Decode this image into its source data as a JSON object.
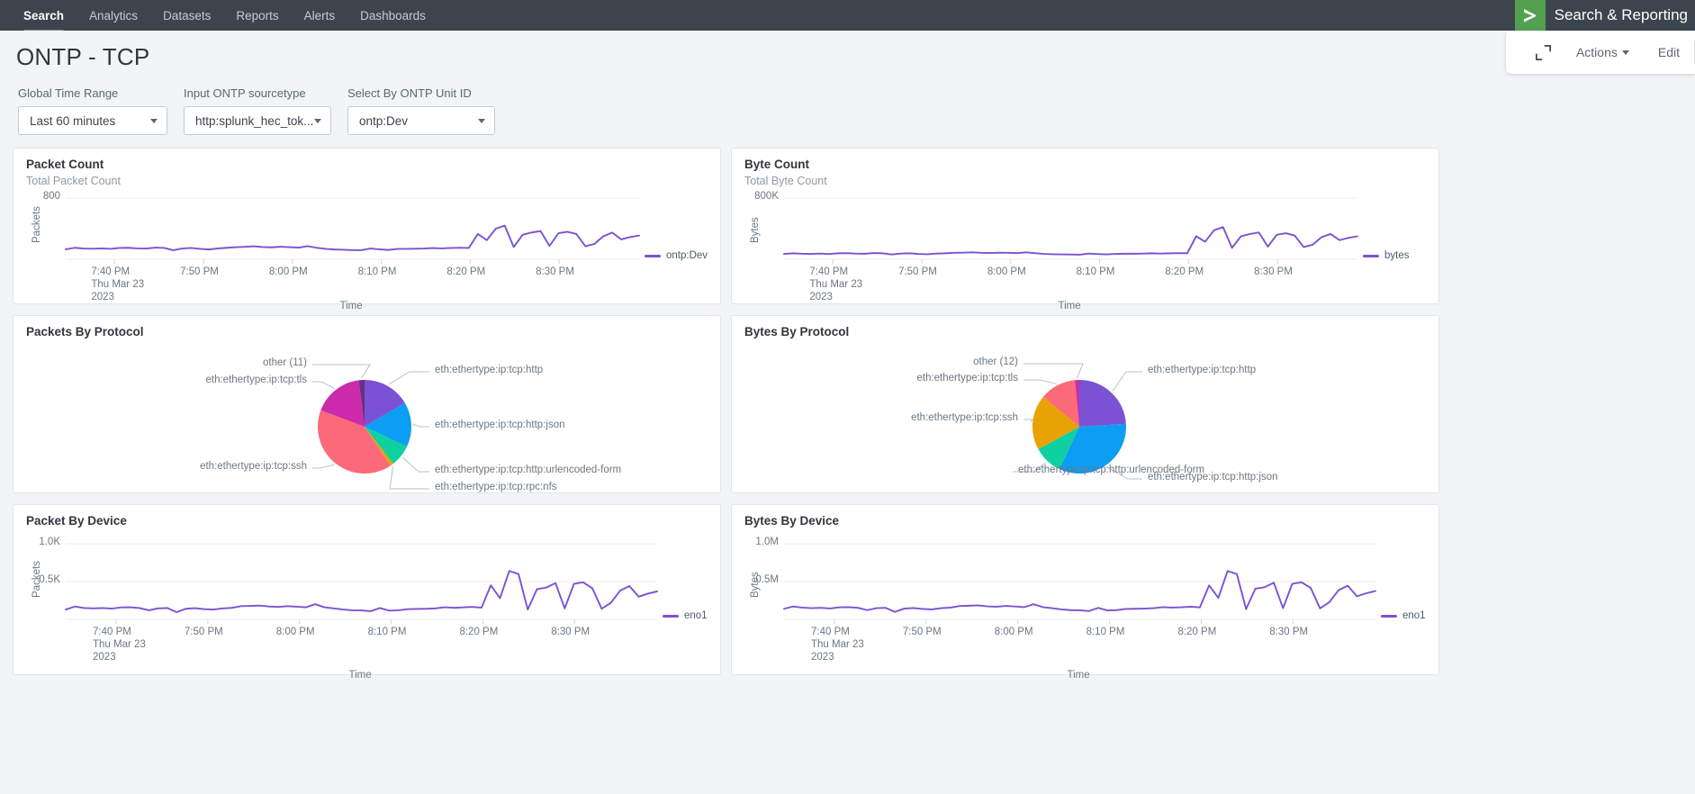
{
  "nav": {
    "items": [
      {
        "label": "Search",
        "active": true
      },
      {
        "label": "Analytics",
        "active": false
      },
      {
        "label": "Datasets",
        "active": false
      },
      {
        "label": "Reports",
        "active": false
      },
      {
        "label": "Alerts",
        "active": false
      },
      {
        "label": "Dashboards",
        "active": false
      }
    ],
    "brand_title": "Search & Reporting",
    "brand_glyph": "›",
    "brand_color": "#53a051"
  },
  "header": {
    "title": "ONTP - TCP",
    "expand_icon": "expand-icon",
    "actions_label": "Actions",
    "edit_label": "Edit"
  },
  "filters": [
    {
      "label": "Global Time Range",
      "value": "Last 60 minutes",
      "name": "global-time-range"
    },
    {
      "label": "Input ONTP sourcetype",
      "value": "http:splunk_hec_tok...",
      "name": "input-ontp-sourcetype"
    },
    {
      "label": "Select By ONTP Unit ID",
      "value": "ontp:Dev",
      "name": "select-by-ontp-unit-id"
    }
  ],
  "panels": {
    "packet_count": {
      "title": "Packet Count",
      "subtitle": "Total Packet Count",
      "legend": "ontp:Dev"
    },
    "byte_count": {
      "title": "Byte Count",
      "subtitle": "Total Byte Count",
      "legend": "bytes"
    },
    "packets_by_protocol": {
      "title": "Packets By Protocol"
    },
    "bytes_by_protocol": {
      "title": "Bytes By Protocol"
    },
    "packet_by_device": {
      "title": "Packet By Device",
      "legend": "eno1"
    },
    "bytes_by_device": {
      "title": "Bytes By Device",
      "legend": "eno1"
    }
  },
  "chart_data": [
    {
      "id": "packet-count",
      "type": "line",
      "title": "Packet Count",
      "subtitle": "Total Packet Count",
      "xlabel": "Time",
      "ylabel": "Packets",
      "ylim": [
        0,
        800
      ],
      "yticks": [
        "800"
      ],
      "xticks": [
        "7:40 PM",
        "7:50 PM",
        "8:00 PM",
        "8:10 PM",
        "8:20 PM",
        "8:30 PM"
      ],
      "x_sublabel": [
        "Thu Mar 23",
        "2023"
      ],
      "grid": true,
      "legend_position": "right",
      "color": "#7b52d3",
      "series": [
        {
          "name": "ontp:Dev",
          "values": [
            130,
            150,
            140,
            138,
            142,
            136,
            148,
            150,
            142,
            140,
            152,
            148,
            118,
            140,
            148,
            136,
            128,
            142,
            150,
            158,
            162,
            170,
            160,
            156,
            164,
            158,
            152,
            172,
            150,
            136,
            128,
            124,
            120,
            118,
            140,
            130,
            122,
            134,
            136,
            138,
            140,
            146,
            142,
            148,
            150,
            148,
            330,
            250,
            400,
            440,
            160,
            320,
            350,
            368,
            175,
            340,
            360,
            330,
            170,
            200,
            300,
            348,
            260,
            290,
            310
          ]
        }
      ]
    },
    {
      "id": "byte-count",
      "type": "line",
      "title": "Byte Count",
      "subtitle": "Total Byte Count",
      "xlabel": "Time",
      "ylabel": "Bytes",
      "ylim": [
        0,
        800000
      ],
      "yticks": [
        "800K"
      ],
      "xticks": [
        "7:40 PM",
        "7:50 PM",
        "8:00 PM",
        "8:10 PM",
        "8:20 PM",
        "8:30 PM"
      ],
      "x_sublabel": [
        "Thu Mar 23",
        "2023"
      ],
      "grid": true,
      "legend_position": "right",
      "color": "#7b52d3",
      "series": [
        {
          "name": "bytes",
          "values": [
            70000,
            78000,
            72000,
            70000,
            74000,
            68000,
            78000,
            80000,
            74000,
            72000,
            82000,
            78000,
            62000,
            74000,
            78000,
            70000,
            66000,
            74000,
            78000,
            84000,
            86000,
            90000,
            84000,
            82000,
            86000,
            84000,
            80000,
            90000,
            80000,
            70000,
            66000,
            64000,
            62000,
            60000,
            74000,
            68000,
            64000,
            70000,
            72000,
            72000,
            74000,
            78000,
            74000,
            78000,
            80000,
            78000,
            300000,
            230000,
            380000,
            420000,
            150000,
            300000,
            330000,
            350000,
            165000,
            320000,
            340000,
            310000,
            160000,
            190000,
            290000,
            330000,
            250000,
            280000,
            300000
          ]
        }
      ]
    },
    {
      "id": "packets-by-protocol",
      "type": "pie",
      "title": "Packets By Protocol",
      "slices": [
        {
          "label": "eth:ethertype:ip:tcp:http",
          "percent": 16.5,
          "color": "#7b52d3"
        },
        {
          "label": "eth:ethertype:ip:tcp:http:json",
          "percent": 15.5,
          "color": "#0b9ef2"
        },
        {
          "label": "eth:ethertype:ip:tcp:http:urlencoded-form",
          "percent": 7.5,
          "color": "#0fd0a0"
        },
        {
          "label": "eth:ethertype:ip:tcp:rpc:nfs",
          "percent": 1.2,
          "color": "#e8a206"
        },
        {
          "label": "eth:ethertype:ip:tcp:ssh",
          "percent": 40.0,
          "color": "#fb6a78"
        },
        {
          "label": "eth:ethertype:ip:tcp:tls",
          "percent": 17.3,
          "color": "#cc2bab"
        },
        {
          "label": "other (11)",
          "percent": 2.0,
          "color": "#6a2e8a"
        }
      ]
    },
    {
      "id": "bytes-by-protocol",
      "type": "pie",
      "title": "Bytes By Protocol",
      "slices": [
        {
          "label": "eth:ethertype:ip:tcp:http",
          "percent": 24.0,
          "color": "#7b52d3"
        },
        {
          "label": "eth:ethertype:ip:tcp:http:json",
          "percent": 33.0,
          "color": "#0b9ef2"
        },
        {
          "label": "eth:ethertype:ip:tcp:http:urlencoded-form",
          "percent": 10.0,
          "color": "#0fd0a0"
        },
        {
          "label": "eth:ethertype:ip:tcp:ssh",
          "percent": 19.0,
          "color": "#e8a206"
        },
        {
          "label": "eth:ethertype:ip:tcp:tls",
          "percent": 12.5,
          "color": "#fb6a78"
        },
        {
          "label": "other (12)",
          "percent": 1.5,
          "color": "#cc2bab"
        }
      ]
    },
    {
      "id": "packet-by-device",
      "type": "line",
      "title": "Packet By Device",
      "xlabel": "Time",
      "ylabel": "Packets",
      "ylim": [
        0,
        1000
      ],
      "yticks": [
        "1.0K",
        "0.5K"
      ],
      "xticks": [
        "7:40 PM",
        "7:50 PM",
        "8:00 PM",
        "8:10 PM",
        "8:20 PM",
        "8:30 PM"
      ],
      "x_sublabel": [
        "Thu Mar 23",
        "2023"
      ],
      "grid": true,
      "legend_position": "right",
      "color": "#7b52d3",
      "series": [
        {
          "name": "eno1",
          "values": [
            130,
            170,
            150,
            145,
            150,
            142,
            158,
            160,
            150,
            120,
            145,
            150,
            95,
            140,
            148,
            135,
            130,
            145,
            152,
            175,
            178,
            182,
            170,
            165,
            175,
            168,
            160,
            200,
            160,
            145,
            130,
            120,
            118,
            108,
            150,
            115,
            120,
            135,
            138,
            140,
            145,
            160,
            152,
            158,
            165,
            155,
            450,
            280,
            640,
            600,
            130,
            400,
            420,
            480,
            145,
            470,
            490,
            410,
            140,
            220,
            380,
            440,
            300,
            340,
            370
          ]
        }
      ]
    },
    {
      "id": "bytes-by-device",
      "type": "line",
      "title": "Bytes By Device",
      "xlabel": "Time",
      "ylabel": "Bytes",
      "ylim": [
        0,
        1000000
      ],
      "yticks": [
        "1.0M",
        "0.5M"
      ],
      "xticks": [
        "7:40 PM",
        "7:50 PM",
        "8:00 PM",
        "8:10 PM",
        "8:20 PM",
        "8:30 PM"
      ],
      "x_sublabel": [
        "Thu Mar 23",
        "2023"
      ],
      "grid": true,
      "legend_position": "right",
      "color": "#7b52d3",
      "series": [
        {
          "name": "eno1",
          "values": [
            140000,
            170000,
            155000,
            148000,
            152000,
            144000,
            160000,
            162000,
            152000,
            122000,
            148000,
            152000,
            98000,
            142000,
            150000,
            138000,
            132000,
            148000,
            155000,
            176000,
            180000,
            185000,
            172000,
            168000,
            178000,
            170000,
            162000,
            200000,
            162000,
            148000,
            132000,
            122000,
            120000,
            110000,
            152000,
            118000,
            122000,
            138000,
            140000,
            142000,
            148000,
            162000,
            155000,
            160000,
            168000,
            158000,
            450000,
            285000,
            640000,
            600000,
            135000,
            405000,
            425000,
            485000,
            148000,
            470000,
            490000,
            415000,
            145000,
            225000,
            385000,
            445000,
            305000,
            345000,
            375000
          ]
        }
      ]
    }
  ]
}
